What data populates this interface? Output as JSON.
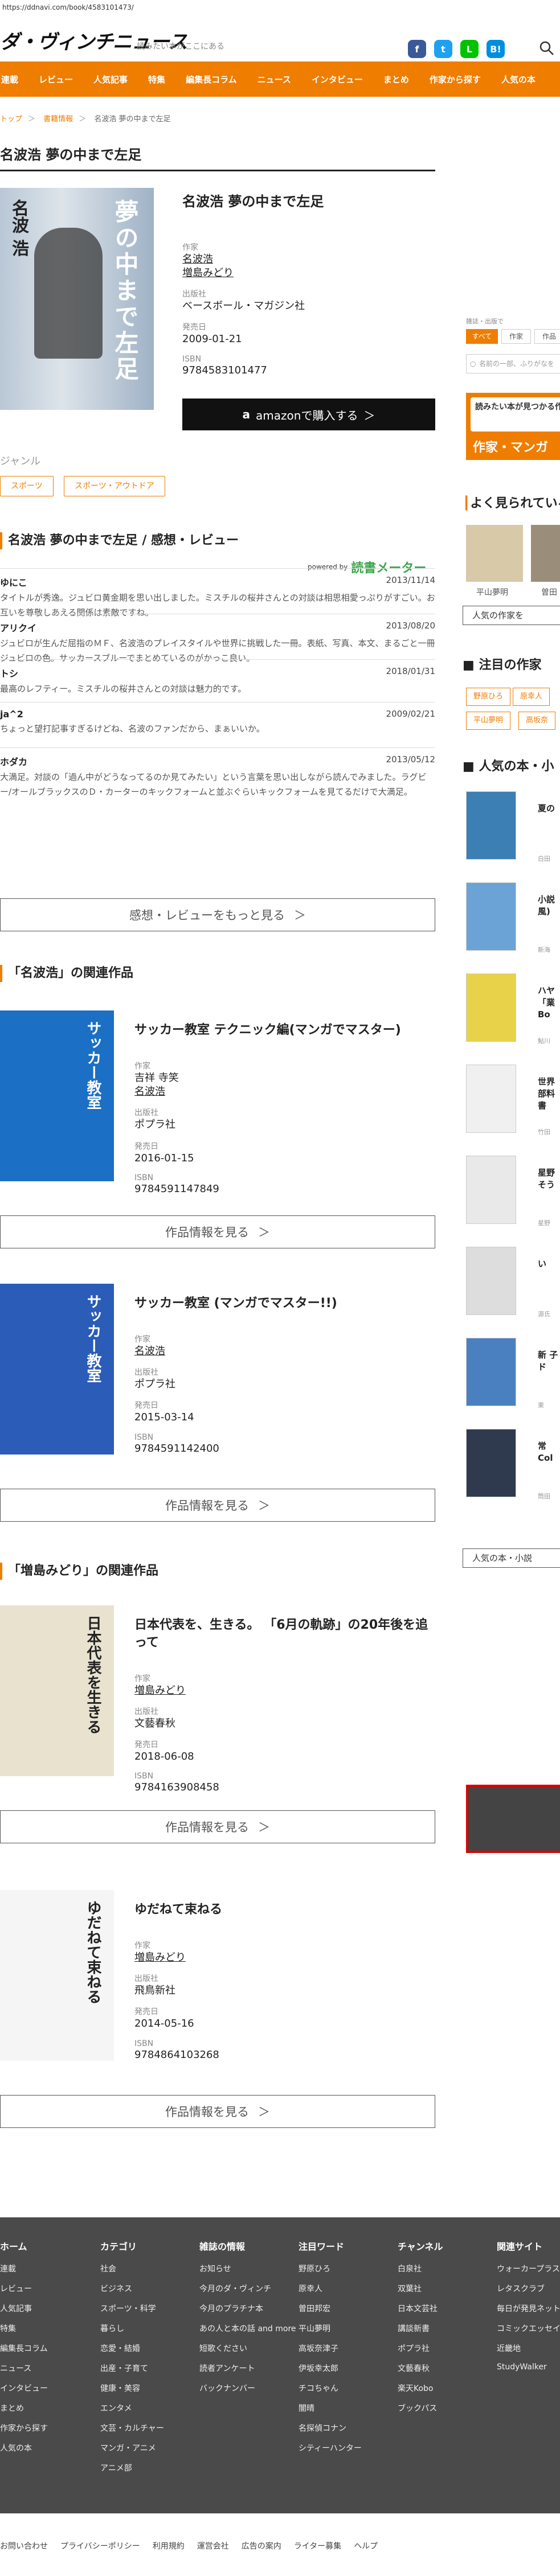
{
  "url": "https://ddnavi.com/book/4583101473/",
  "site": {
    "logo": "ダ・ヴィンチニュース",
    "tagline": "読みたい本がここにある",
    "social": [
      {
        "name": "facebook",
        "glyph": "f",
        "color": "#3b5998"
      },
      {
        "name": "twitter",
        "glyph": "t",
        "color": "#1da1f2"
      },
      {
        "name": "line",
        "glyph": "L",
        "color": "#00c300"
      },
      {
        "name": "hatena",
        "glyph": "B!",
        "color": "#008fde"
      }
    ],
    "accent": "#ef7d00"
  },
  "nav": [
    "連載",
    "レビュー",
    "人気記事",
    "特集",
    "編集長コラム",
    "ニュース",
    "インタビュー",
    "まとめ",
    "作家から探す",
    "人気の本"
  ],
  "breadcrumb": [
    "トップ",
    "書籍情報",
    "名波浩 夢の中まで左足"
  ],
  "page_title": "名波浩 夢の中まで左足",
  "book": {
    "title": "名波浩 夢の中まで左足",
    "cover_title": "夢の中まで左足",
    "cover_name": "名波 浩",
    "labels": {
      "author": "作家",
      "publisher": "出版社",
      "date": "発売日",
      "isbn": "ISBN"
    },
    "authors": [
      "名波浩",
      "増島みどり"
    ],
    "publisher": "ベースボール・マガジン社",
    "date": "2009-01-21",
    "isbn": "9784583101477",
    "amazon_button": "amazonで購入する"
  },
  "genre": {
    "label": "ジャンル",
    "tags": [
      "スポーツ",
      "スポーツ・アウトドア"
    ]
  },
  "reviews_section": {
    "heading": "名波浩 夢の中まで左足 / 感想・レビュー",
    "powered_by": "powered by",
    "brand": "読書メーター",
    "more_button": "感想・レビューをもっと見る",
    "items": [
      {
        "user": "ゆにこ",
        "date": "2013/11/14",
        "text": "タイトルが秀逸。ジュビロ黄金期を思い出しました。ミスチルの桜井さんとの対談は相思相愛っぷりがすごい。お互いを尊敬しあえる関係は素敵ですね。"
      },
      {
        "user": "アリクイ",
        "date": "2013/08/20",
        "text": "ジュビロが生んだ屈指のＭＦ、名波浩のプレイスタイルや世界に挑戦した一冊。表紙、写真、本文、まるごと一冊ジュビロの色。サッカースブルーでまとめているのがかっこ良い。"
      },
      {
        "user": "トシ",
        "date": "2018/01/31",
        "text": "最高のレフティー。ミスチルの桜井さんとの対談は魅力的です。"
      },
      {
        "user": "ja^2",
        "date": "2009/02/21",
        "text": "ちょっと望打記事すぎるけどね、名波のファンだから、まぁいいか。"
      },
      {
        "user": "ホダカ",
        "date": "2013/05/12",
        "text": "大満足。対談の「過ん中がどうなってるのか見てみたい」という言葉を思い出しながら読んでみました。ラグビー/オールブラックスのＤ・カーターのキックフォームと並ぶぐらいキックフォームを見てるだけで大満足。"
      }
    ]
  },
  "related_nanami": {
    "heading": "「名波浩」の関連作品",
    "items": [
      {
        "title": "サッカー教室 テクニック編(マンガでマスター)",
        "authors": [
          "吉祥 寺笑",
          "名波浩"
        ],
        "publisher": "ポプラ社",
        "date": "2016-01-15",
        "isbn": "9784591147849",
        "cover_text": "サッカー教室",
        "cover_color": "#1b6fc4"
      },
      {
        "title": "サッカー教室 (マンガでマスター!!)",
        "authors": [
          "名波浩"
        ],
        "publisher": "ポプラ社",
        "date": "2015-03-14",
        "isbn": "9784591142400",
        "cover_text": "サッカー教室",
        "cover_color": "#2a5cb8"
      }
    ]
  },
  "related_masujima": {
    "heading": "「増島みどり」の関連作品",
    "items": [
      {
        "title": "日本代表を、生きる。 「6月の軌跡」の20年後を追って",
        "authors": [
          "増島みどり"
        ],
        "publisher": "文藝春秋",
        "date": "2018-06-08",
        "isbn": "9784163908458",
        "cover_text": "日本代表を生きる",
        "cover_color": "#e8e2cf"
      },
      {
        "title": "ゆだねて束ねる",
        "authors": [
          "増島みどり"
        ],
        "publisher": "飛鳥新社",
        "date": "2014-05-16",
        "isbn": "9784864103268",
        "cover_text": "ゆだねて束ねる",
        "cover_color": "#f5f5f5"
      }
    ]
  },
  "work_button": "作品情報を見る",
  "sidebar": {
    "search_caption": "雑誌・出版で",
    "search_tabs": [
      "すべて",
      "作家",
      "作品"
    ],
    "search_placeholder": "名前の一部、ふりがなを",
    "banner_top": "読みたい本が見つかる作品",
    "banner_bottom": "作家・マンガ",
    "popular_authors_head": "よく見られている",
    "popular_authors": [
      "平山夢明",
      "曽田"
    ],
    "popular_authors_btn": "人気の作家を",
    "featured_head": "注目の作家",
    "featured_tags": [
      "野原ひろ",
      "原幸人",
      "江戸川",
      "平山夢明",
      "高坂奈"
    ],
    "popular_books_head": "人気の本・小",
    "popular_books": [
      {
        "title": "夏の",
        "sub": "白田"
      },
      {
        "title": "小説 風)",
        "sub": "新海"
      },
      {
        "title": "ハヤ「業Bo",
        "sub": "鮎川"
      },
      {
        "title": "世界 部料 書",
        "sub": "竹田"
      },
      {
        "title": "星野 そう",
        "sub": "星野"
      },
      {
        "title": "い",
        "sub": "源氏"
      },
      {
        "title": "新 子 ド",
        "sub": "東"
      },
      {
        "title": "常 Col",
        "sub": "筒田"
      }
    ],
    "popular_books_btn": "人気の本・小説"
  },
  "footer": {
    "columns": [
      {
        "head": "ホーム",
        "items": [
          "連載",
          "レビュー",
          "人気記事",
          "特集",
          "編集長コラム",
          "ニュース",
          "インタビュー",
          "まとめ",
          "作家から探す",
          "人気の本"
        ]
      },
      {
        "head": "カテゴリ",
        "items": [
          "社会",
          "ビジネス",
          "スポーツ・科学",
          "暮らし",
          "恋愛・結婚",
          "出産・子育て",
          "健康・美容",
          "エンタメ",
          "文芸・カルチャー",
          "マンガ・アニメ",
          "アニメ部"
        ]
      },
      {
        "head": "雑誌の情報",
        "items": [
          "お知らせ",
          "今月のダ・ヴィンチ",
          "今月のプラチナ本",
          "あの人と本の話 and more",
          "短歌ください",
          "読者アンケート",
          "バックナンバー"
        ]
      },
      {
        "head": "注目ワード",
        "items": [
          "野原ひろ",
          "原幸人",
          "曽田邦宏",
          "平山夢明",
          "高坂奈津子",
          "伊坂幸太郎",
          "チコちゃん",
          "闇晴",
          "名探偵コナン",
          "シティーハンター"
        ]
      },
      {
        "head": "チャンネル",
        "items": [
          "白泉社",
          "双葉社",
          "日本文芸社",
          "講談新書",
          "ポプラ社",
          "文藝春秋",
          "楽天Kobo",
          "ブックパス"
        ]
      },
      {
        "head": "関連サイト",
        "items": [
          "ウォーカープラス",
          "レタスクラブ",
          "毎日が発見ネット",
          "コミックエッセイ",
          "近畿地",
          "StudyWalker"
        ]
      }
    ],
    "bottom_links": [
      "お問い合わせ",
      "プライバシーポリシー",
      "利用規約",
      "運営会社",
      "広告の案内",
      "ライター募集",
      "ヘルプ"
    ]
  }
}
